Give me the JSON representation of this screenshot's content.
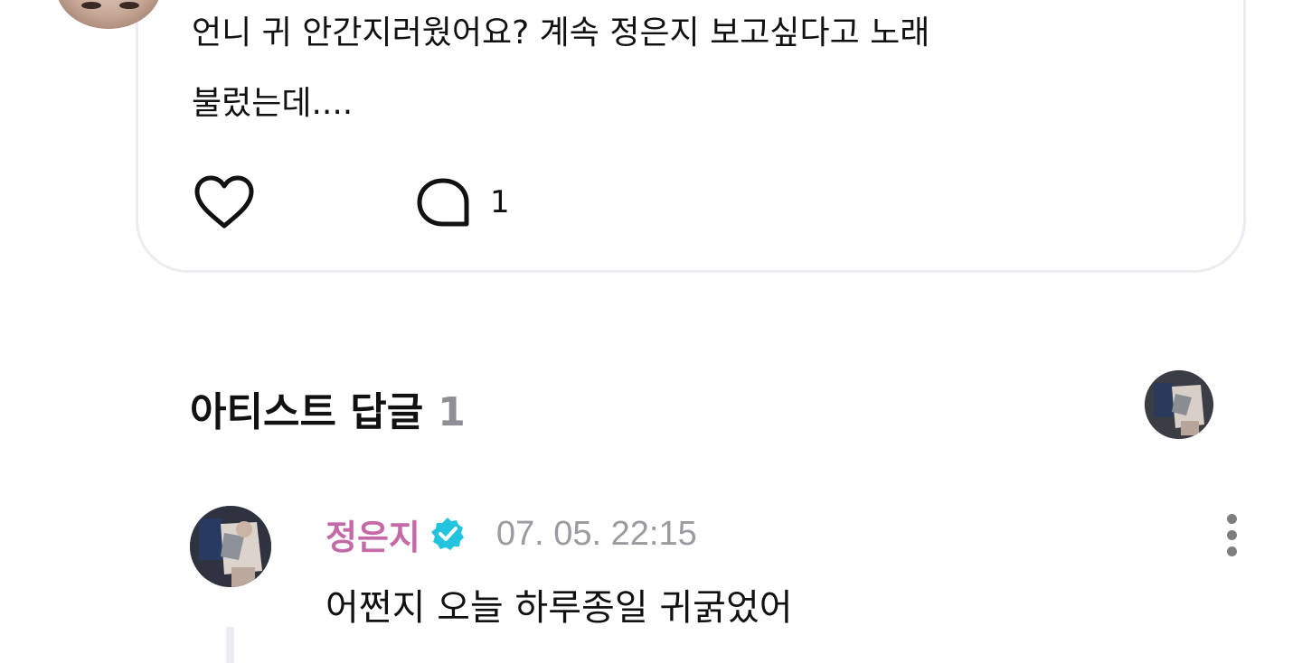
{
  "post": {
    "text": "언니 귀 안간지러웠어요? 계속 정은지 보고싶다고 노래\n불렀는데....",
    "comment_count": "1"
  },
  "artist_replies": {
    "title": "아티스트 답글",
    "count": "1"
  },
  "reply": {
    "author": "정은지",
    "timestamp": "07. 05. 22:15",
    "text": "어쩐지 오늘 하루종일 귀굵었어"
  },
  "colors": {
    "author": "#c46aa6",
    "verified_badge": "#22c3dc",
    "muted": "#9a9aa0",
    "card_border": "#ececf1"
  },
  "icons": {
    "like": "heart-icon",
    "comment": "comment-bubble-icon",
    "verified": "verified-badge-icon",
    "more": "more-vertical-icon"
  }
}
